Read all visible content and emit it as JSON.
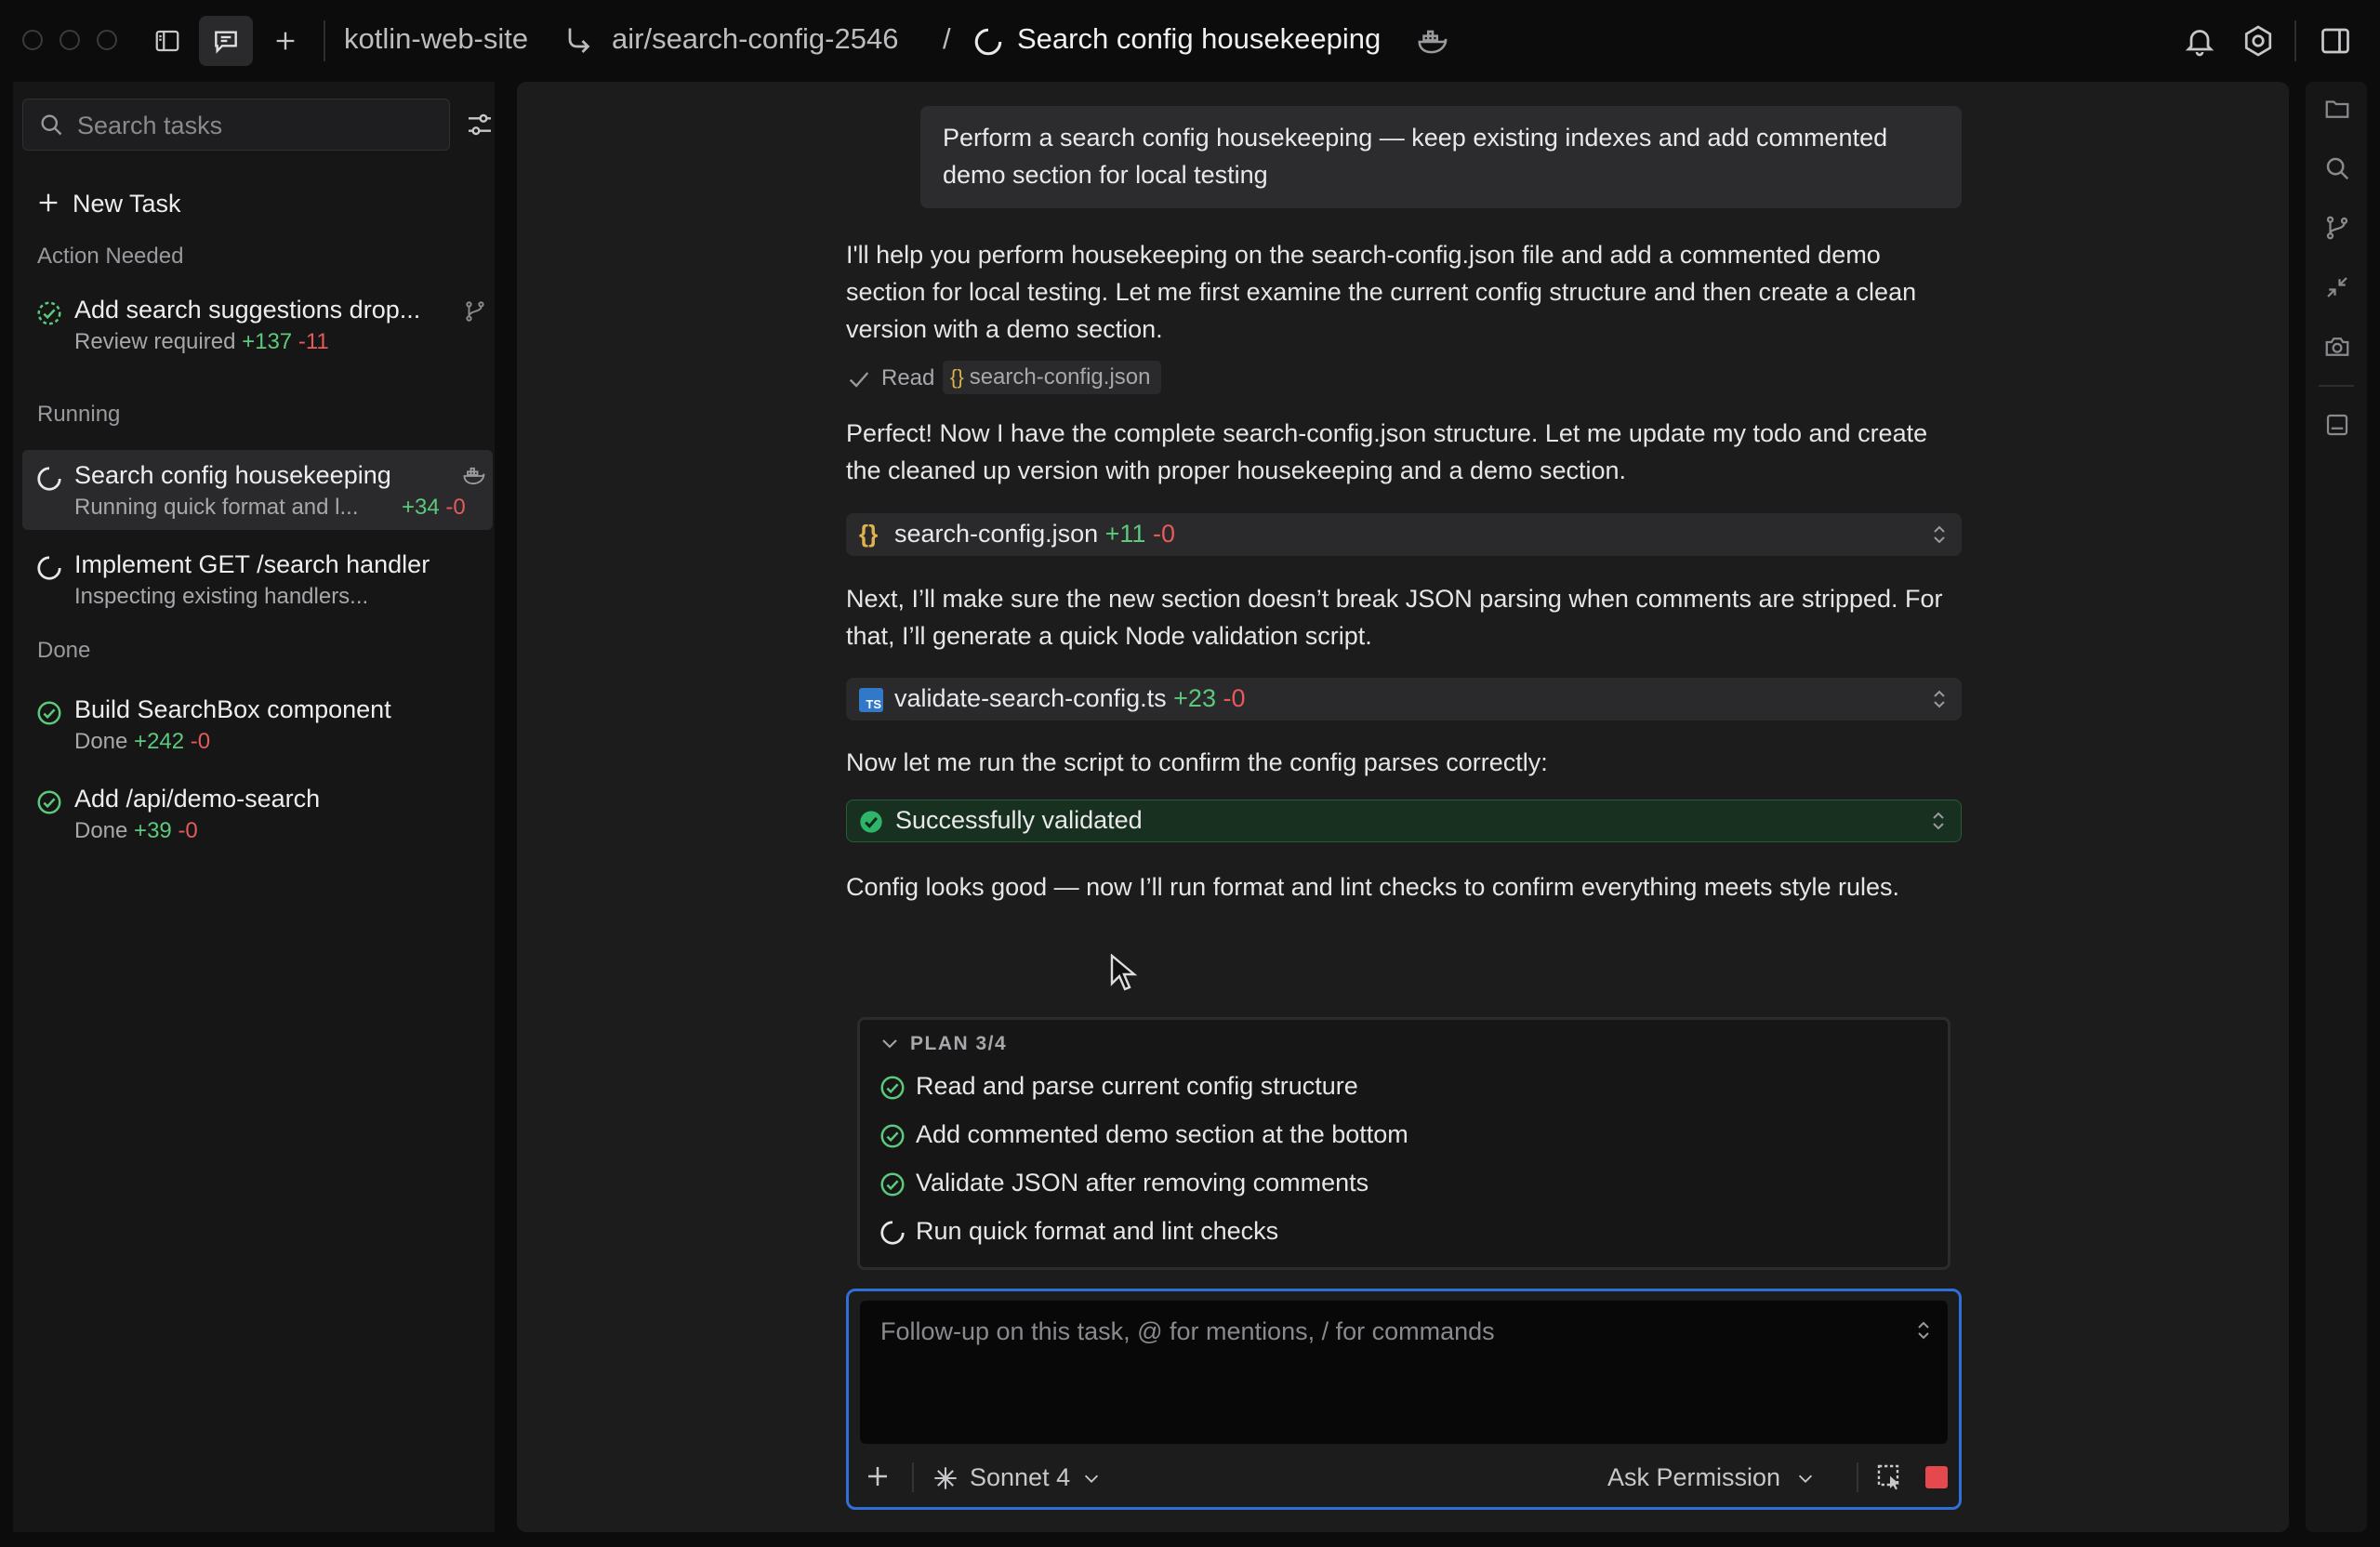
{
  "titlebar": {
    "repo": "kotlin-web-site",
    "branch": "air/search-config-2546",
    "separator": "/",
    "task_title": "Search config housekeeping"
  },
  "sidebar": {
    "search_placeholder": "Search tasks",
    "new_task_label": "New Task",
    "sections": {
      "action_needed": "Action Needed",
      "running": "Running",
      "done": "Done"
    },
    "tasks": [
      {
        "title": "Add search suggestions drop...",
        "status": "Review required",
        "added": "+137",
        "removed": "-11"
      },
      {
        "title": "Search config housekeeping",
        "status": "Running quick format and l...",
        "added": "+34",
        "removed": "-0"
      },
      {
        "title": "Implement GET /search handler",
        "status": "Inspecting existing handlers..."
      },
      {
        "title": "Build SearchBox component",
        "status": "Done",
        "added": "+242",
        "removed": "-0"
      },
      {
        "title": "Add /api/demo-search",
        "status": "Done",
        "added": "+39",
        "removed": "-0"
      }
    ]
  },
  "conversation": {
    "user_message": "Perform a search config housekeeping — keep existing indexes and add commented demo section for local testing",
    "msg1": "I'll help you perform housekeeping on the search-config.json file and add a commented demo section for local testing. Let me first examine the current config structure and then create a clean version with a demo section.",
    "read_label": "Read",
    "read_file": "search-config.json",
    "msg2": "Perfect! Now I have the complete search-config.json structure. Let me update my todo and create the cleaned up version with proper housekeeping and a demo section.",
    "file1": {
      "name": "search-config.json",
      "added": "+11",
      "removed": "-0"
    },
    "msg3": "Next, I’ll make sure the new section doesn’t break JSON parsing when comments are stripped. For that, I’ll generate a quick Node validation script.",
    "file2": {
      "name": "validate-search-config.ts",
      "added": "+23",
      "removed": "-0",
      "icon_text": "TS"
    },
    "msg4": "Now let me run the script to confirm the config parses correctly:",
    "validation_label": "Successfully validated",
    "msg5": "Config looks good — now I’ll run format and lint checks to confirm everything meets style rules."
  },
  "plan": {
    "title": "PLAN 3/4",
    "items": [
      {
        "label": "Read and parse current config structure",
        "done": true
      },
      {
        "label": "Add commented demo section at the bottom",
        "done": true
      },
      {
        "label": "Validate JSON after removing comments",
        "done": true
      },
      {
        "label": "Run quick format and lint checks",
        "done": false
      }
    ]
  },
  "composer": {
    "placeholder": "Follow-up on this task, @ for mentions, / for commands",
    "model": "Sonnet 4",
    "permission": "Ask Permission"
  },
  "colors": {
    "accent_blue": "#2f6fd6",
    "added_green": "#5cc97b",
    "removed_red": "#e65a5a",
    "stop_red": "#e5484d",
    "success_green": "#2fb56a"
  }
}
